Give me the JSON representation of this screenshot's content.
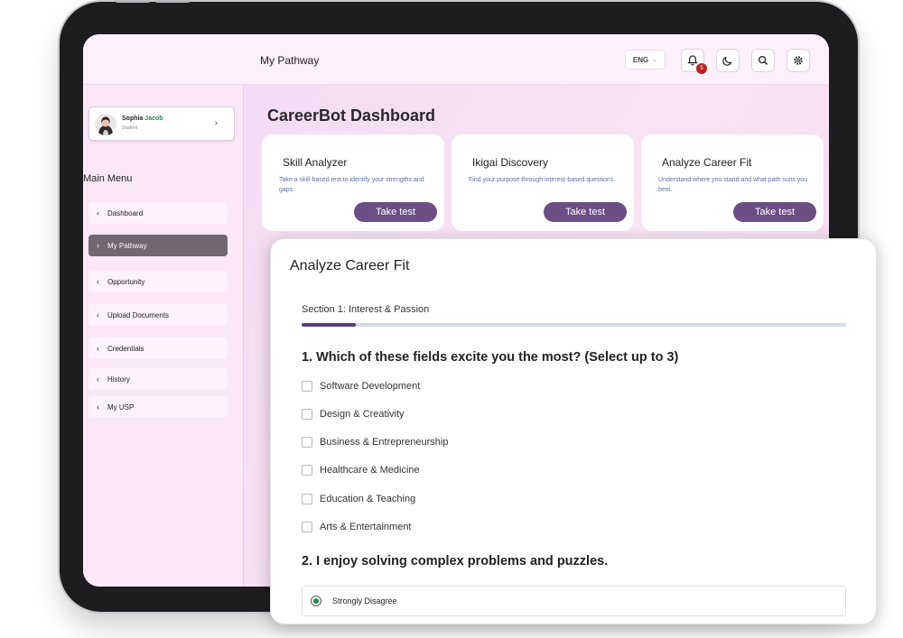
{
  "header": {
    "page_title": "My Pathway",
    "language": "ENG",
    "notification_count": "5"
  },
  "profile": {
    "first_name": "Sophia",
    "last_name": "Jacob",
    "role": "Student"
  },
  "sidebar": {
    "menu_title": "Main Menu",
    "items": [
      {
        "label": "Dashboard",
        "icon": "chevron-left-icon",
        "active": false
      },
      {
        "label": "My Pathway",
        "icon": "chevron-right-icon",
        "active": true
      },
      {
        "label": "Opportunity",
        "icon": "chevron-left-icon",
        "active": false
      },
      {
        "label": "Upload Documents",
        "icon": "chevron-left-icon",
        "active": false
      },
      {
        "label": "Credentials",
        "icon": "chevron-left-icon",
        "active": false
      },
      {
        "label": "History",
        "icon": "chevron-left-icon",
        "active": false
      },
      {
        "label": "My USP",
        "icon": "chevron-left-icon",
        "active": false
      }
    ]
  },
  "dashboard": {
    "title": "CareerBot Dashboard",
    "cards": [
      {
        "title": "Skill Analyzer",
        "description": "Take a skill-based test to identify your strengths and gaps.",
        "button": "Take test"
      },
      {
        "title": "Ikigai Discovery",
        "description": "Find your purpose through interest-based questions.",
        "button": "Take test"
      },
      {
        "title": "Analyze Career Fit",
        "description": "Understand where you stand and what path suits you best.",
        "button": "Take test"
      }
    ]
  },
  "career_fit": {
    "title": "Analyze Career Fit",
    "section_label": "Section 1: Interest & Passion",
    "progress_fraction": 0.1,
    "question1": "1. Which of these fields excite you the most? (Select up to 3)",
    "options": [
      "Software Development",
      "Design & Creativity",
      "Business & Entrepreneurship",
      "Healthcare & Medicine",
      "Education & Teaching",
      "Arts & Entertainment"
    ],
    "question2": "2. I enjoy solving complex problems and puzzles.",
    "answer": "Strongly Disagree"
  },
  "colors": {
    "accent": "#6a4f84",
    "progress": "#5d3a84",
    "active_menu": "#74666f",
    "badge": "#b32626",
    "name_highlight": "#1f8a4c"
  }
}
